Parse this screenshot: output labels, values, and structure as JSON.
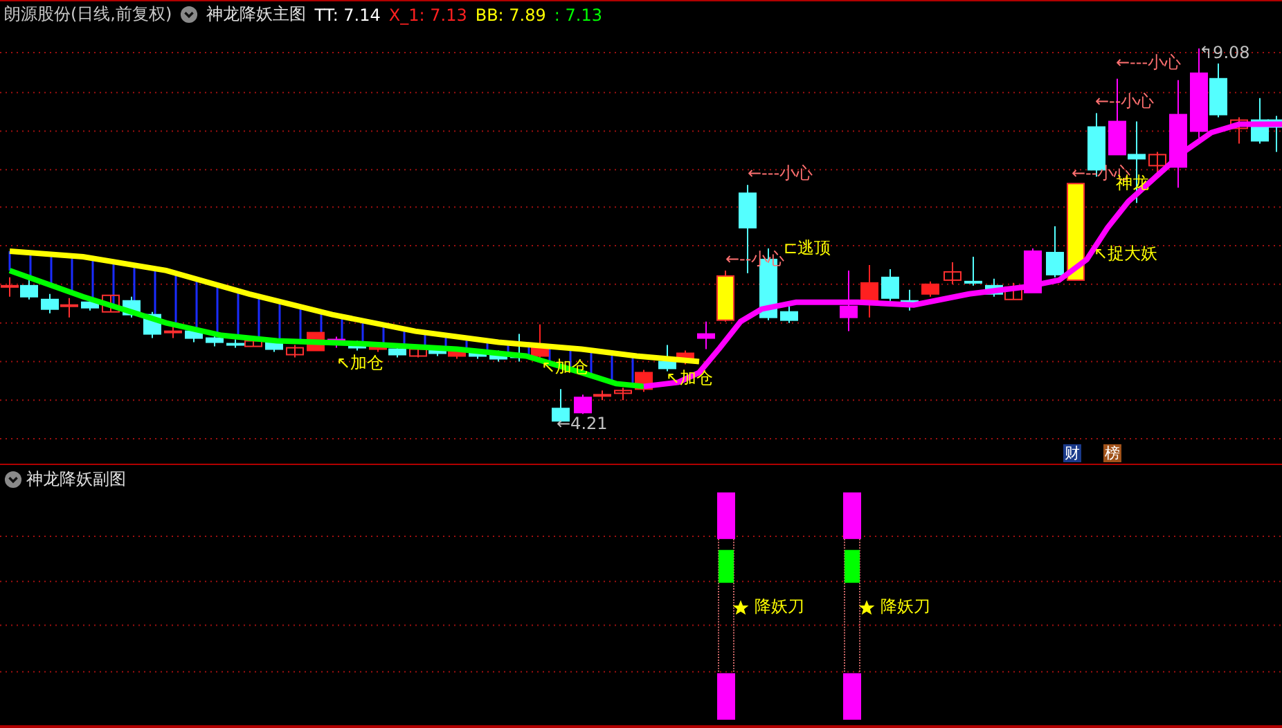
{
  "main_panel": {
    "stock_title": "朗源股份(日线,前复权)",
    "indicator": "神龙降妖主图",
    "readouts": [
      {
        "text": "TT: 7.14",
        "color": "#ffffff"
      },
      {
        "text": "X_1: 7.13",
        "color": "#ff2020"
      },
      {
        "text": "BB: 7.89",
        "color": "#ffff00"
      },
      {
        "text": ": 7.13",
        "color": "#00ff00"
      }
    ],
    "annotations": [
      {
        "text": "←---小心",
        "color": "#ff7070"
      },
      {
        "text": "←--小心",
        "color": "#ff7070"
      },
      {
        "text": "⊏逃顶",
        "color": "#ffff00"
      },
      {
        "text": "←---小心",
        "color": "#ff7070"
      },
      {
        "text": "←--小心",
        "color": "#ff7070"
      },
      {
        "text": "←--小心",
        "color": "#ff7070"
      },
      {
        "text": "神龙",
        "color": "#ffff00"
      },
      {
        "text": "↖捉大妖",
        "color": "#ffff00"
      },
      {
        "text": "↖加仓",
        "color": "#ffff00"
      },
      {
        "text": "↖加仓",
        "color": "#ffff00"
      },
      {
        "text": "↖加仓",
        "color": "#ffff00"
      },
      {
        "text": "↰9.08",
        "color": "#c0c0c0"
      },
      {
        "text": "←4.21",
        "color": "#c0c0c0"
      }
    ],
    "badges": [
      {
        "text": "财",
        "color": "#1a3a8a"
      },
      {
        "text": "榜",
        "color": "#a0521a"
      }
    ]
  },
  "sub_panel": {
    "indicator": "神龙降妖副图",
    "signals": [
      {
        "text": "降妖刀"
      },
      {
        "text": "降妖刀"
      }
    ]
  }
}
